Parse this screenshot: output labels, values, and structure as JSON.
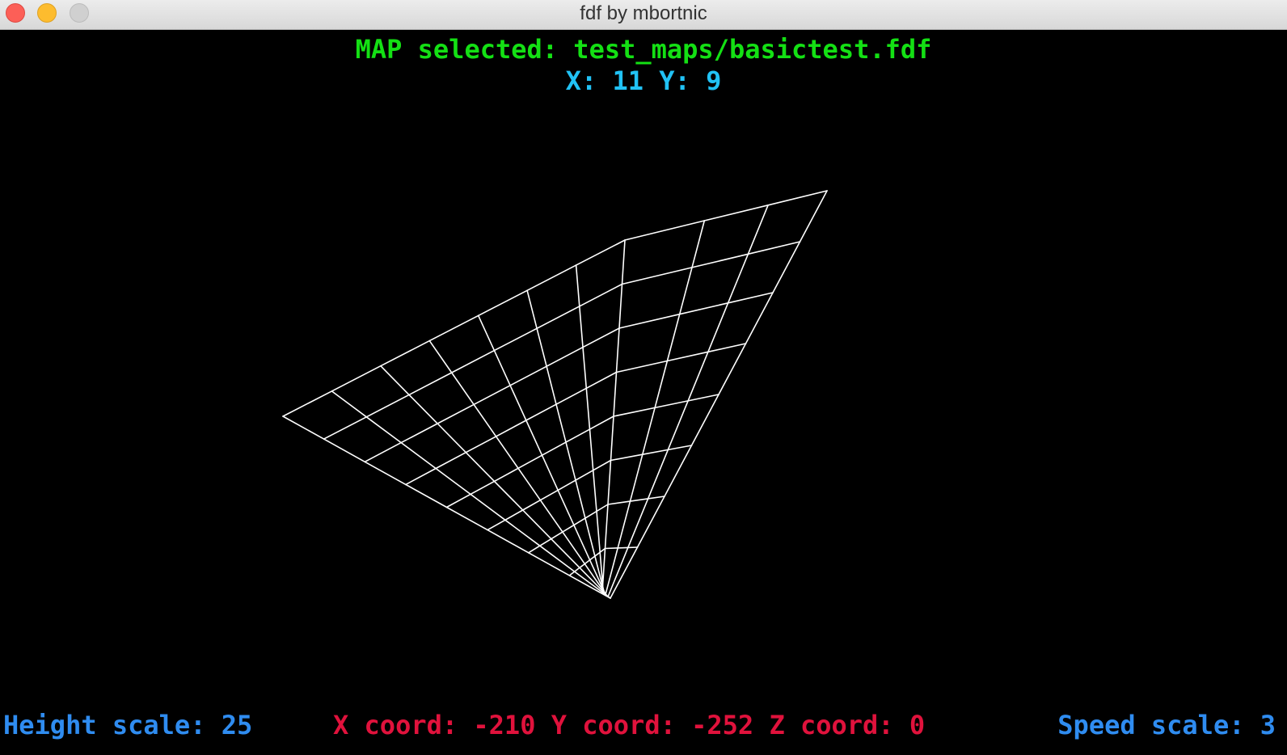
{
  "window": {
    "title": "fdf by mbortnic",
    "buttons": {
      "close_color": "#fc5f57",
      "minimize_color": "#fdbc2e",
      "zoom_color": "#d0d0d0"
    }
  },
  "hud": {
    "map_selected": "MAP selected: test_maps/basictest.fdf",
    "dimensions": "X: 11 Y: 9",
    "height_scale": "Height scale: 25",
    "coords": "X coord: -210 Y coord: -252 Z coord: 0",
    "speed_scale": "Speed scale: 3"
  },
  "colors": {
    "map_text": "#14e014",
    "dimensions_text": "#21c2f5",
    "scale_text": "#2f8cf0",
    "coords_text": "#e0123c",
    "wireframe": "#ffffff",
    "background": "#000000"
  },
  "wireframe": {
    "columns": 11,
    "rows": 9,
    "height_scale": 25
  }
}
